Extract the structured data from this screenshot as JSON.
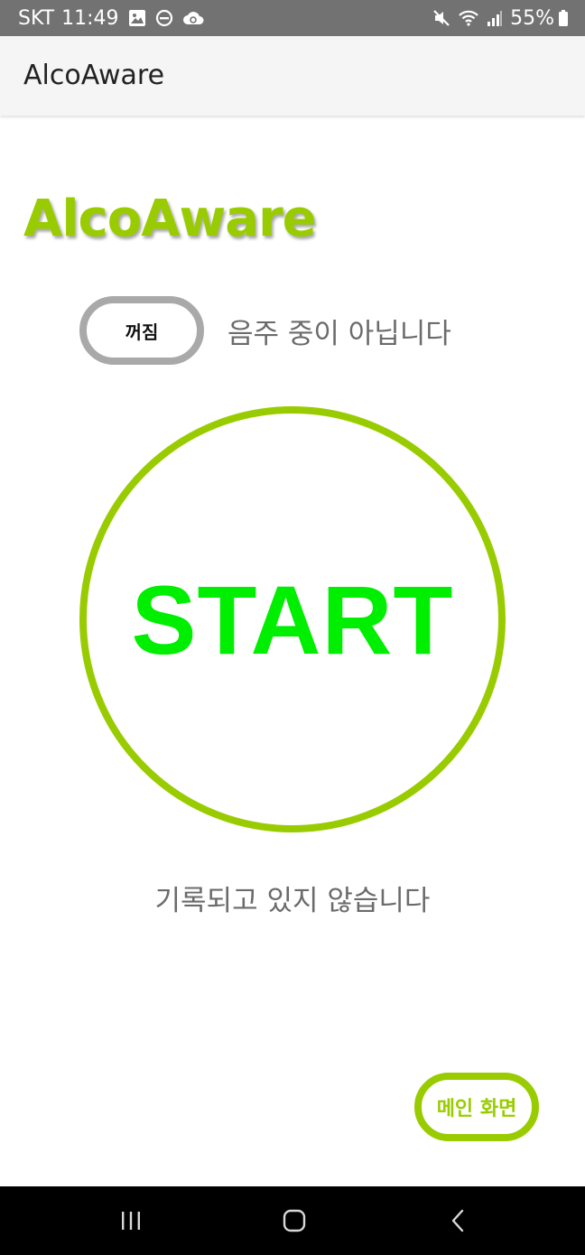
{
  "status_bar": {
    "carrier": "SKT",
    "time": "11:49",
    "battery_percent": "55%",
    "left_icons": [
      "image-icon",
      "do-not-disturb-icon",
      "cloud-sync-icon"
    ],
    "right_icons": [
      "mute-icon",
      "wifi-icon",
      "signal-icon",
      "battery-icon"
    ]
  },
  "app_bar": {
    "title": "AlcoAware"
  },
  "main": {
    "brand_title": "AlcoAware",
    "toggle_label": "꺼짐",
    "drinking_status": "음주 중이 아닙니다",
    "start_label": "START",
    "record_status": "기록되고 있지 않습니다",
    "main_screen_label": "메인 화면"
  },
  "nav_bar": {
    "buttons": [
      "recent-apps-icon",
      "home-icon",
      "back-icon"
    ]
  },
  "colors": {
    "accent": "#99cc00",
    "start_text": "#00ee00",
    "toggle_border": "#a9a9a9",
    "status_text": "#6b6b6b",
    "status_bar_bg": "#727272"
  }
}
